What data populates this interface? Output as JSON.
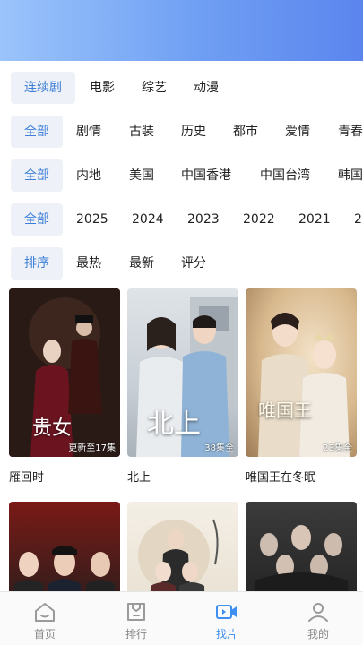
{
  "category_tabs": [
    "连续剧",
    "电影",
    "综艺",
    "动漫"
  ],
  "genre_filter": [
    "全部",
    "剧情",
    "古装",
    "历史",
    "都市",
    "爱情",
    "青春"
  ],
  "region_filter": [
    "全部",
    "内地",
    "美国",
    "中国香港",
    "中国台湾",
    "韩国"
  ],
  "year_filter": [
    "全部",
    "2025",
    "2024",
    "2023",
    "2022",
    "2021",
    "2"
  ],
  "sort_filter": [
    "排序",
    "最热",
    "最新",
    "评分"
  ],
  "posters": [
    {
      "title": "雁回时",
      "badge": "更新至17集",
      "art_text": "贵女"
    },
    {
      "title": "北上",
      "badge": "38集全",
      "art_text": "北上"
    },
    {
      "title": "唯国王在冬眠",
      "badge": "23集全",
      "art_text": "唯国王"
    },
    {
      "title": "",
      "badge": "",
      "art_text": ""
    },
    {
      "title": "",
      "badge": "",
      "art_text": ""
    },
    {
      "title": "",
      "badge": "",
      "art_text": ""
    }
  ],
  "bottom_nav": [
    {
      "label": "首页",
      "icon": "home-icon"
    },
    {
      "label": "排行",
      "icon": "ranking-icon"
    },
    {
      "label": "找片",
      "icon": "video-camera-icon"
    },
    {
      "label": "我的",
      "icon": "person-icon"
    }
  ],
  "colors": {
    "accent": "#3d7fd8",
    "header_gradient_start": "#9bc4fb",
    "header_gradient_end": "#5b85ee",
    "tab_active": "#3d8ff0"
  }
}
